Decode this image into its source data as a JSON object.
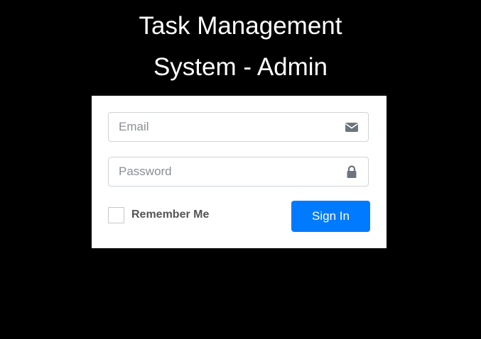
{
  "header": {
    "title_line1": "Task Management",
    "title_line2": "System - Admin"
  },
  "login_form": {
    "email": {
      "placeholder": "Email",
      "value": "",
      "icon": "envelope-icon"
    },
    "password": {
      "placeholder": "Password",
      "value": "",
      "icon": "lock-icon"
    },
    "remember_me": {
      "label": "Remember Me",
      "checked": false
    },
    "submit_label": "Sign In"
  },
  "colors": {
    "background": "#000000",
    "card": "#ffffff",
    "primary_button": "#007bff",
    "icon": "#6c757d"
  }
}
